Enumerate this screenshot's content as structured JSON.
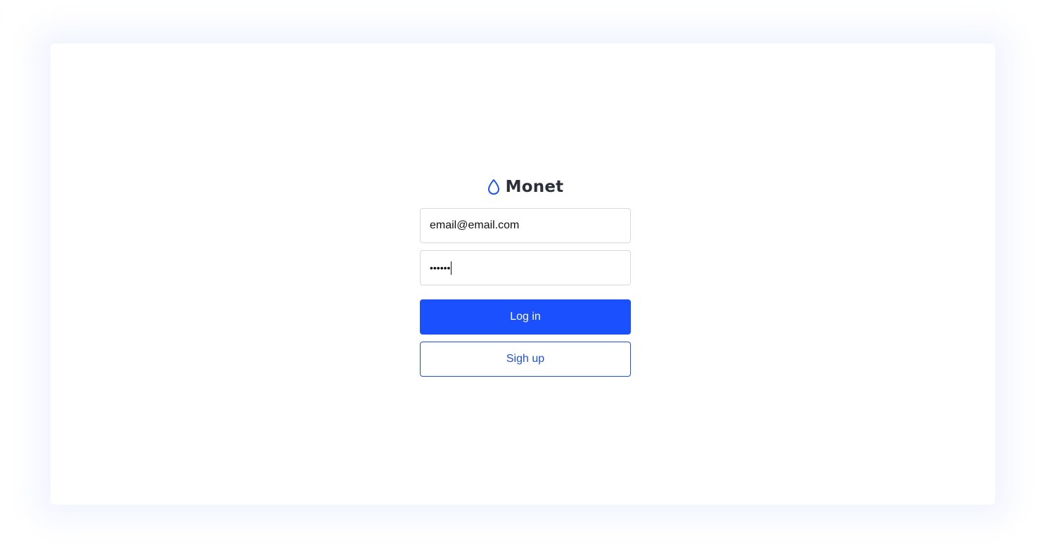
{
  "brand": {
    "name": "Monet",
    "icon": "drop-icon",
    "accent": "#1a50fe"
  },
  "form": {
    "email_value": "email@email.com",
    "password_mask": "••••••"
  },
  "buttons": {
    "login_label": "Log in",
    "signup_label": "Sigh up"
  }
}
